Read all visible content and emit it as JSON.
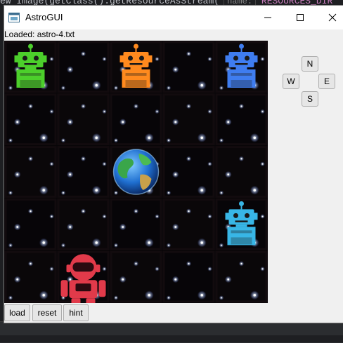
{
  "editor": {
    "code_line": "ew Image(getClass().getResourceAsStream(",
    "hint": "name:",
    "const": "RESOURCES_DIR"
  },
  "window": {
    "title": "AstroGUI"
  },
  "status": {
    "text": "Loaded: astro-4.txt"
  },
  "controls": {
    "north": "N",
    "west": "W",
    "east": "E",
    "south": "S"
  },
  "toolbar": {
    "load": "load",
    "reset": "reset",
    "hint": "hint"
  },
  "board": {
    "rows": 5,
    "cols": 5,
    "robots": [
      {
        "row": 0,
        "col": 0,
        "color": "#4ccf2b",
        "icon": "robot-green-icon"
      },
      {
        "row": 0,
        "col": 2,
        "color": "#ff8a1e",
        "icon": "robot-orange-icon"
      },
      {
        "row": 0,
        "col": 4,
        "color": "#3f7df0",
        "icon": "robot-blue-icon"
      },
      {
        "row": 3,
        "col": 4,
        "color": "#38b6e6",
        "icon": "robot-cyan-icon"
      }
    ],
    "astronaut": {
      "row": 4,
      "col": 1,
      "color": "#e13a4a",
      "icon": "astronaut-icon"
    },
    "planet": {
      "row": 2,
      "col": 2,
      "icon": "earth-icon"
    }
  }
}
